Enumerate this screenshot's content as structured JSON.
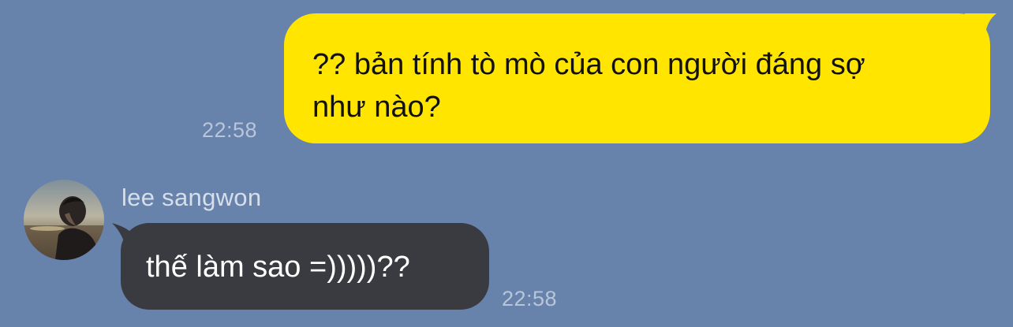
{
  "colors": {
    "background": "#6783ac",
    "outgoing_bubble": "#ffe500",
    "incoming_bubble": "#3a3b40",
    "timestamp": "#b9c5d8",
    "sender_name": "#d6deea"
  },
  "messages": {
    "outgoing": {
      "text_line_1": "?? bản tính tò mò của con người đáng sợ",
      "text_line_2": "như nào?",
      "time": "22:58"
    },
    "incoming": {
      "sender": "lee sangwon",
      "text": "thế làm sao =)))))??",
      "time": "22:58",
      "avatar_icon": "user-avatar-photo"
    }
  }
}
